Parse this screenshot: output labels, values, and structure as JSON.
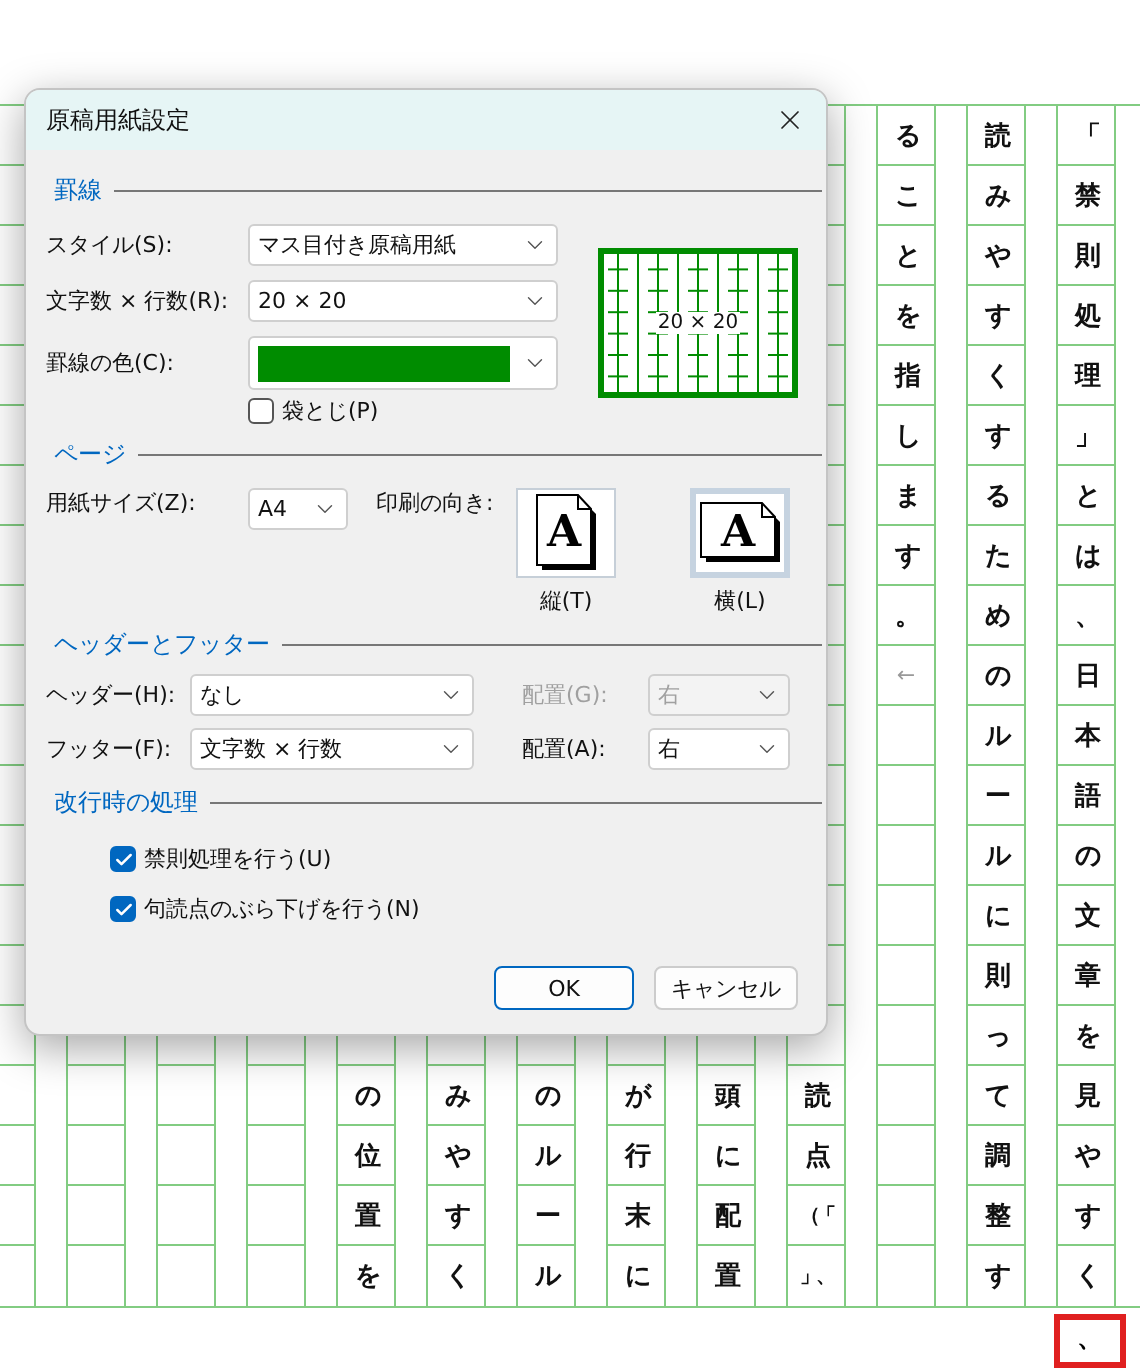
{
  "manuscript": {
    "columns": [
      {
        "kind": "tail",
        "cells": [
          "の",
          "位",
          "置",
          "を"
        ]
      },
      {
        "kind": "tail",
        "cells": [
          "み",
          "や",
          "す",
          "く"
        ]
      },
      {
        "kind": "tail",
        "cells": [
          "の",
          "ル",
          "ー",
          "ル"
        ]
      },
      {
        "kind": "tail",
        "cells": [
          "が",
          "行",
          "末",
          "に"
        ]
      },
      {
        "kind": "tail",
        "cells": [
          "頭",
          "に",
          "配",
          "置"
        ]
      },
      {
        "kind": "tail",
        "cells": [
          "読",
          "点",
          "（「",
          "」、"
        ]
      },
      {
        "kind": "head",
        "cells": [
          "る",
          "こ",
          "と",
          "を",
          "指",
          "し",
          "ま",
          "す",
          "。"
        ],
        "paragraph_mark": "←"
      },
      {
        "kind": "head",
        "cells": [
          "読",
          "み",
          "や",
          "す",
          "く",
          "す",
          "る",
          "た",
          "め",
          "の",
          "ル",
          "ー",
          "ル",
          "に",
          "則",
          "っ",
          "て",
          "調",
          "整",
          "す"
        ]
      },
      {
        "kind": "head",
        "cells": [
          "「",
          "禁",
          "則",
          "処",
          "理",
          "」",
          "と",
          "は",
          "、",
          "日",
          "本",
          "語",
          "の",
          "文",
          "章",
          "を",
          "見",
          "や",
          "す",
          "く"
        ]
      }
    ],
    "hanging_mark": {
      "text": "、",
      "highlighted": true
    }
  },
  "dialog": {
    "title": "原稿用紙設定",
    "ruled_lines": {
      "title": "罫線",
      "style": {
        "label": "スタイル(S):",
        "value": "マス目付き原稿用紙"
      },
      "size": {
        "label": "文字数 × 行数(R):",
        "value": "20 × 20"
      },
      "line_color": {
        "label": "罫線の色(C):",
        "color": "#008c00"
      },
      "bound_pages": {
        "label": "袋とじ(P)",
        "checked": false
      },
      "preview": {
        "text": "20 × 20"
      }
    },
    "page": {
      "title": "ページ",
      "paper_size": {
        "label": "用紙サイズ(Z):",
        "value": "A4"
      },
      "orientation": {
        "label": "印刷の向き:",
        "options": [
          {
            "kind": "portrait",
            "glyph": "A",
            "label": "縦(T)",
            "selected": false
          },
          {
            "kind": "landscape",
            "glyph": "A",
            "label": "横(L)",
            "selected": true
          }
        ]
      }
    },
    "header_footer": {
      "title": "ヘッダーとフッター",
      "rows": [
        {
          "label": "ヘッダー(H):",
          "value": "なし",
          "align_label": "配置(G):",
          "align_value": "右",
          "align_disabled": true
        },
        {
          "label": "フッター(F):",
          "value": "文字数 × 行数",
          "align_label": "配置(A):",
          "align_value": "右",
          "align_disabled": false
        }
      ]
    },
    "line_break": {
      "title": "改行時の処理",
      "options": [
        {
          "label": "禁則処理を行う(U)",
          "checked": true
        },
        {
          "label": "句読点のぶら下げを行う(N)",
          "checked": true
        }
      ]
    },
    "buttons": [
      {
        "label": "OK",
        "default": true
      },
      {
        "label": "キャンセル",
        "default": false
      }
    ]
  }
}
